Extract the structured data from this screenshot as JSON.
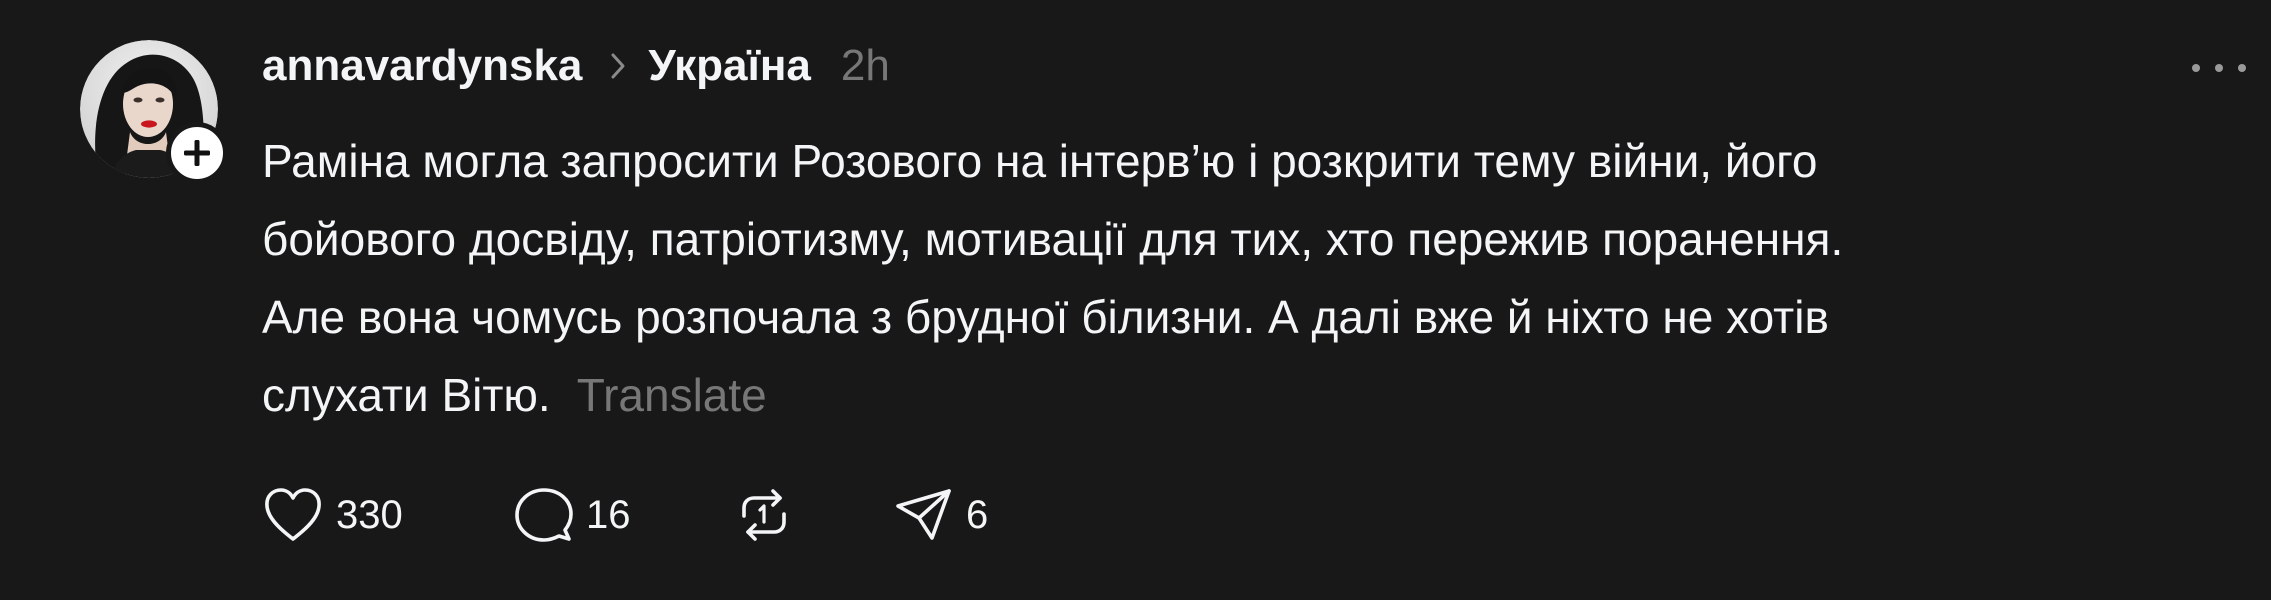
{
  "post": {
    "author": {
      "username": "annavardynska",
      "avatar": "profile-photo"
    },
    "topic": "Україна",
    "timestamp": "2h",
    "body_lines": [
      "Раміна могла запросити Розового на інтерв’ю і розкрити тему війни, його",
      "бойового досвіду, патріотизму, мотивації для тих, хто пережив поранення.",
      "Але вона чомусь розпочала з брудної білизни. А далі вже й ніхто не хотів",
      "слухати Вітю."
    ],
    "translate_label": "Translate",
    "actions": {
      "likes": "330",
      "replies": "16",
      "shares": "6"
    }
  },
  "icons": {
    "follow": "plus-icon",
    "separator": "chevron-right-icon",
    "more": "more-horizontal-icon",
    "like": "heart-icon",
    "reply": "comment-icon",
    "repost": "repost-icon",
    "share": "send-icon"
  },
  "colors": {
    "background": "#181818",
    "primary_text": "#f3f5f7",
    "secondary_text": "#777777"
  }
}
